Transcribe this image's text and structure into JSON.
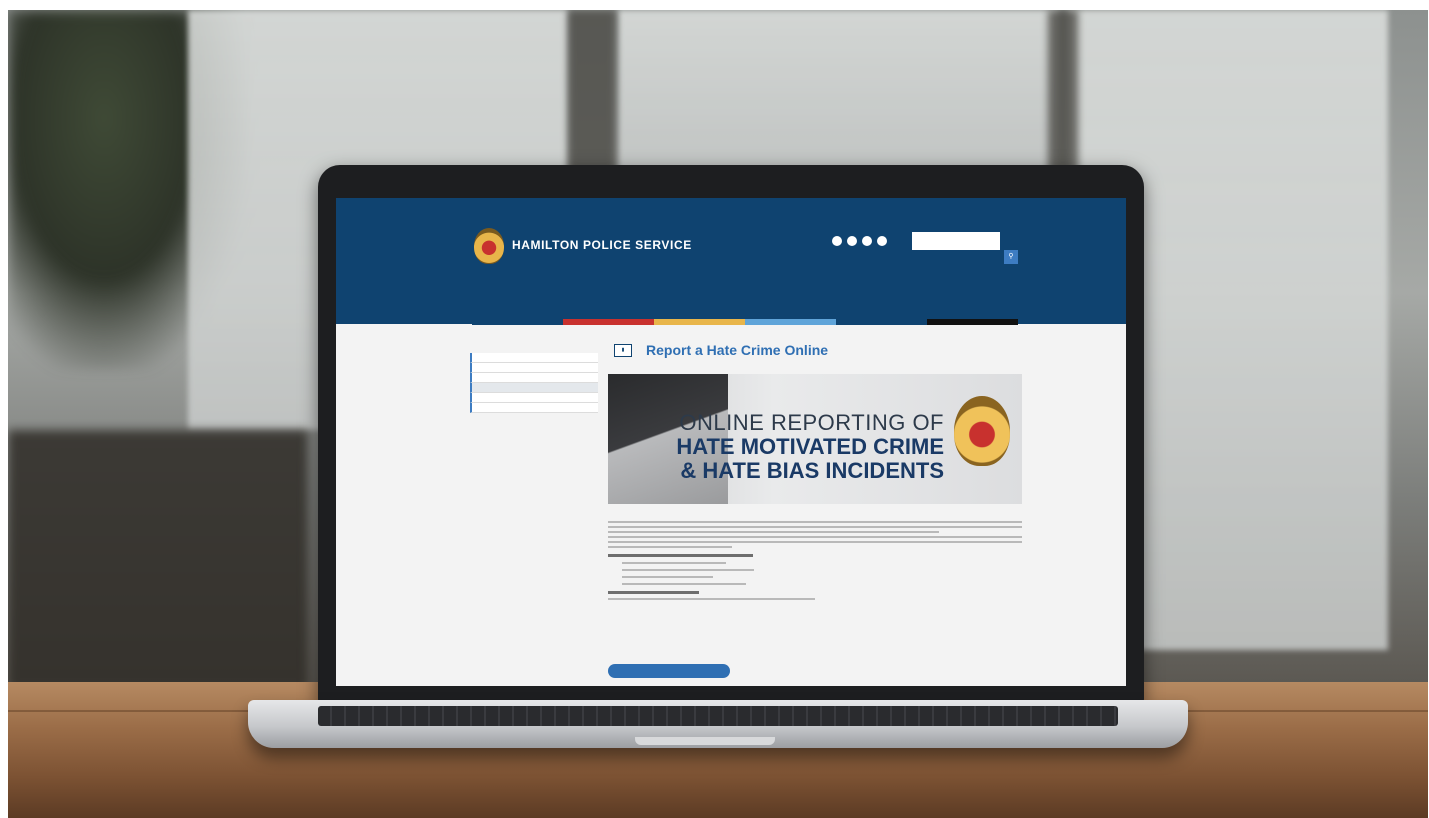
{
  "header": {
    "site_title": "HAMILTON POLICE SERVICE"
  },
  "page": {
    "title": "Report a Hate Crime Online"
  },
  "banner": {
    "line1": "ONLINE REPORTING OF",
    "line2": "HATE MOTIVATED CRIME",
    "line3": "& HATE BIAS INCIDENTS"
  },
  "nav_colors": [
    "#0f4370",
    "#c8312e",
    "#e8b54a",
    "#5fa4d9",
    "#0f4370",
    "#111111"
  ]
}
